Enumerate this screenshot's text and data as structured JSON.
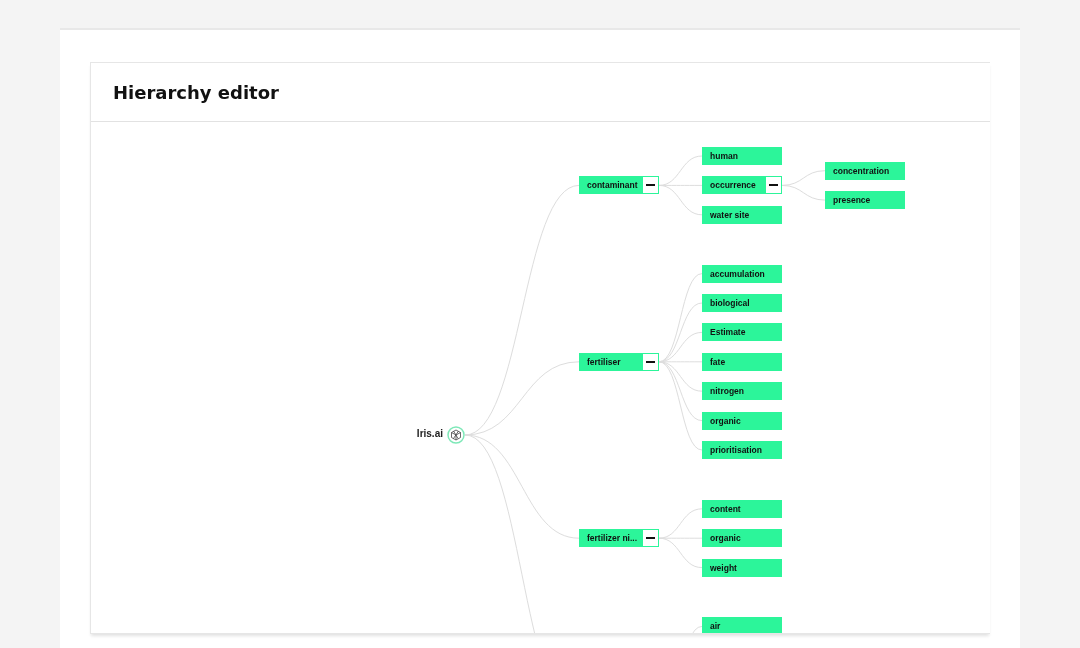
{
  "title": "Hierarchy editor",
  "root": {
    "label": "Iris.ai",
    "children": [
      {
        "label": "contaminant",
        "expanded": true,
        "children": [
          {
            "label": "human"
          },
          {
            "label": "occurrence",
            "expanded": true,
            "children": [
              {
                "label": "concentration"
              },
              {
                "label": "presence"
              }
            ]
          },
          {
            "label": "water site"
          }
        ]
      },
      {
        "label": "fertiliser",
        "expanded": true,
        "children": [
          {
            "label": "accumulation"
          },
          {
            "label": "biological"
          },
          {
            "label": "Estimate"
          },
          {
            "label": "fate"
          },
          {
            "label": "nitrogen"
          },
          {
            "label": "organic"
          },
          {
            "label": "prioritisation"
          }
        ]
      },
      {
        "label": "fertilizer ni...",
        "expanded": true,
        "children": [
          {
            "label": "content"
          },
          {
            "label": "organic"
          },
          {
            "label": "weight"
          }
        ]
      },
      {
        "children": [
          {
            "label": "air"
          }
        ]
      }
    ]
  }
}
